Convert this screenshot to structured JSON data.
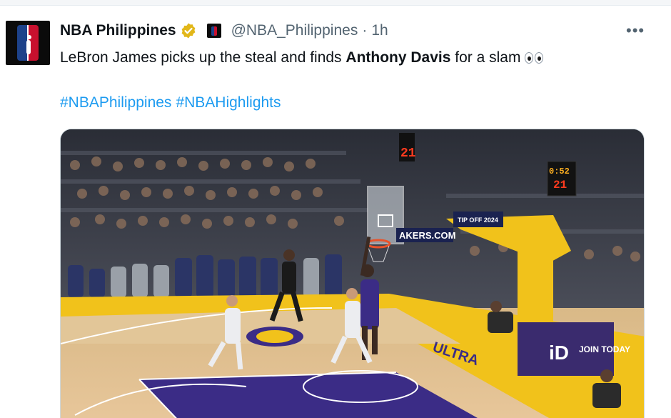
{
  "tweet": {
    "display_name": "NBA Philippines",
    "handle": "@NBA_Philippines",
    "separator": "·",
    "time": "1h",
    "more": "•••",
    "text_before": "LeBron James picks up the steal and finds ",
    "text_bold": "Anthony Davis",
    "text_after": " for a slam",
    "hashtags": [
      "#NBAPhilippines",
      "#NBAHighlights"
    ]
  },
  "media": {
    "type": "video-still",
    "shot_clock": "21",
    "game_clock": "0:52",
    "game_clock_alt": "21",
    "board_text": "AKERS.COM",
    "banner_text": "TIP OFF 2024",
    "court_text": "ULTRA",
    "sign_text_1": "iD",
    "sign_text_2": "JOIN TODAY"
  },
  "colors": {
    "link": "#1d9bf0",
    "secondary": "#536471",
    "court_gold": "#f1c21b",
    "court_purple": "#3b2c86",
    "verified_gold": "#e2b719"
  }
}
